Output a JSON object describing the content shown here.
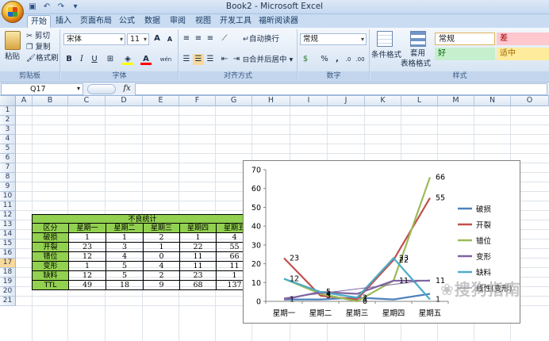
{
  "window": {
    "title": "Book2 - Microsoft Excel",
    "qat": [
      "save-icon",
      "undo-icon",
      "redo-icon",
      "customize-icon"
    ]
  },
  "tabs": [
    "开始",
    "插入",
    "页面布局",
    "公式",
    "数据",
    "审阅",
    "视图",
    "开发工具",
    "福昕阅读器"
  ],
  "ribbon": {
    "clipboard": {
      "paste": "粘贴",
      "cut": "剪切",
      "copy": "复制",
      "format_painter": "格式刷",
      "label": "剪贴板"
    },
    "font": {
      "name": "宋体",
      "size": "11",
      "bold": "B",
      "italic": "I",
      "underline": "U",
      "font_color": "A",
      "phonetic": "wén",
      "grow": "A",
      "shrink": "A",
      "label": "字体"
    },
    "alignment": {
      "wrap": "自动换行",
      "merge": "合并后居中",
      "label": "对齐方式"
    },
    "number": {
      "format": "常规",
      "percent": "%",
      "comma": ",",
      "inc_decimal": ".0",
      "dec_decimal": ".00",
      "currency": "$",
      "label": "数字"
    },
    "styles": {
      "conditional": "条件格式",
      "table": "套用\n表格格式",
      "table_line1": "套用",
      "table_line2": "表格格式",
      "normal": "常规",
      "bad": "差",
      "good": "好",
      "neutral": "适中",
      "label": "样式"
    }
  },
  "formula_bar": {
    "name_box": "Q17",
    "fx": "fx",
    "content": ""
  },
  "grid": {
    "columns": [
      "A",
      "B",
      "C",
      "D",
      "E",
      "F",
      "G",
      "H",
      "I",
      "J",
      "K",
      "L",
      "M",
      "N",
      "O"
    ],
    "rows": [
      "1",
      "2",
      "3",
      "4",
      "5",
      "6",
      "7",
      "8",
      "9",
      "10",
      "11",
      "12",
      "13",
      "14",
      "15",
      "16",
      "17",
      "18",
      "19",
      "20",
      "21"
    ],
    "selected_row": "17"
  },
  "table": {
    "title": "不良统计",
    "headers": [
      "区分",
      "星期一",
      "星期二",
      "星期三",
      "星期四",
      "星期五"
    ],
    "rows": [
      [
        "破损",
        "1",
        "1",
        "2",
        "1",
        "4"
      ],
      [
        "开裂",
        "23",
        "3",
        "1",
        "22",
        "55"
      ],
      [
        "错位",
        "12",
        "4",
        "0",
        "11",
        "66"
      ],
      [
        "变形",
        "1",
        "5",
        "4",
        "11",
        "11"
      ],
      [
        "缺料",
        "12",
        "5",
        "2",
        "23",
        "1"
      ],
      [
        "TTL",
        "49",
        "18",
        "9",
        "68",
        "137"
      ]
    ]
  },
  "chart_data": {
    "type": "line",
    "categories": [
      "星期一",
      "星期二",
      "星期三",
      "星期四",
      "星期五"
    ],
    "ylim": [
      0,
      70
    ],
    "yticks": [
      "0",
      "10",
      "20",
      "30",
      "40",
      "50",
      "60",
      "70"
    ],
    "grid": false,
    "legend": "right",
    "series": [
      {
        "name": "破损",
        "color": "#4f81bd",
        "values": [
          1,
          1,
          2,
          1,
          4
        ]
      },
      {
        "name": "开裂",
        "color": "#c0504d",
        "values": [
          23,
          3,
          1,
          22,
          55
        ]
      },
      {
        "name": "错位",
        "color": "#9bbb59",
        "values": [
          12,
          4,
          0,
          11,
          66
        ]
      },
      {
        "name": "变形",
        "color": "#8064a2",
        "values": [
          1,
          5,
          4,
          11,
          11
        ]
      },
      {
        "name": "缺料",
        "color": "#4bacc6",
        "values": [
          12,
          5,
          2,
          23,
          1
        ]
      }
    ],
    "trendline": {
      "name": "线性(变形)",
      "color": "#8064a2",
      "values": [
        1.8,
        4.2,
        6.6,
        9.0,
        11.4
      ]
    },
    "data_labels": [
      {
        "text": "23",
        "series": 1,
        "index": 0
      },
      {
        "text": "12",
        "series": 4,
        "index": 0
      },
      {
        "text": "1",
        "series": 0,
        "index": 0
      },
      {
        "text": "5",
        "series": 4,
        "index": 1
      },
      {
        "text": "4",
        "series": 2,
        "index": 1
      },
      {
        "text": "3",
        "series": 1,
        "index": 1
      },
      {
        "text": "1",
        "series": 1,
        "index": 2
      },
      {
        "text": "2",
        "series": 0,
        "index": 2
      },
      {
        "text": "0",
        "series": 2,
        "index": 2
      },
      {
        "text": "23",
        "series": 4,
        "index": 3
      },
      {
        "text": "22",
        "series": 1,
        "index": 3
      },
      {
        "text": "11",
        "series": 3,
        "index": 3
      },
      {
        "text": "66",
        "series": 2,
        "index": 4
      },
      {
        "text": "55",
        "series": 1,
        "index": 4
      },
      {
        "text": "11",
        "series": 3,
        "index": 4
      },
      {
        "text": "1",
        "series": 4,
        "index": 4
      }
    ]
  },
  "watermark": "搜狗指南"
}
